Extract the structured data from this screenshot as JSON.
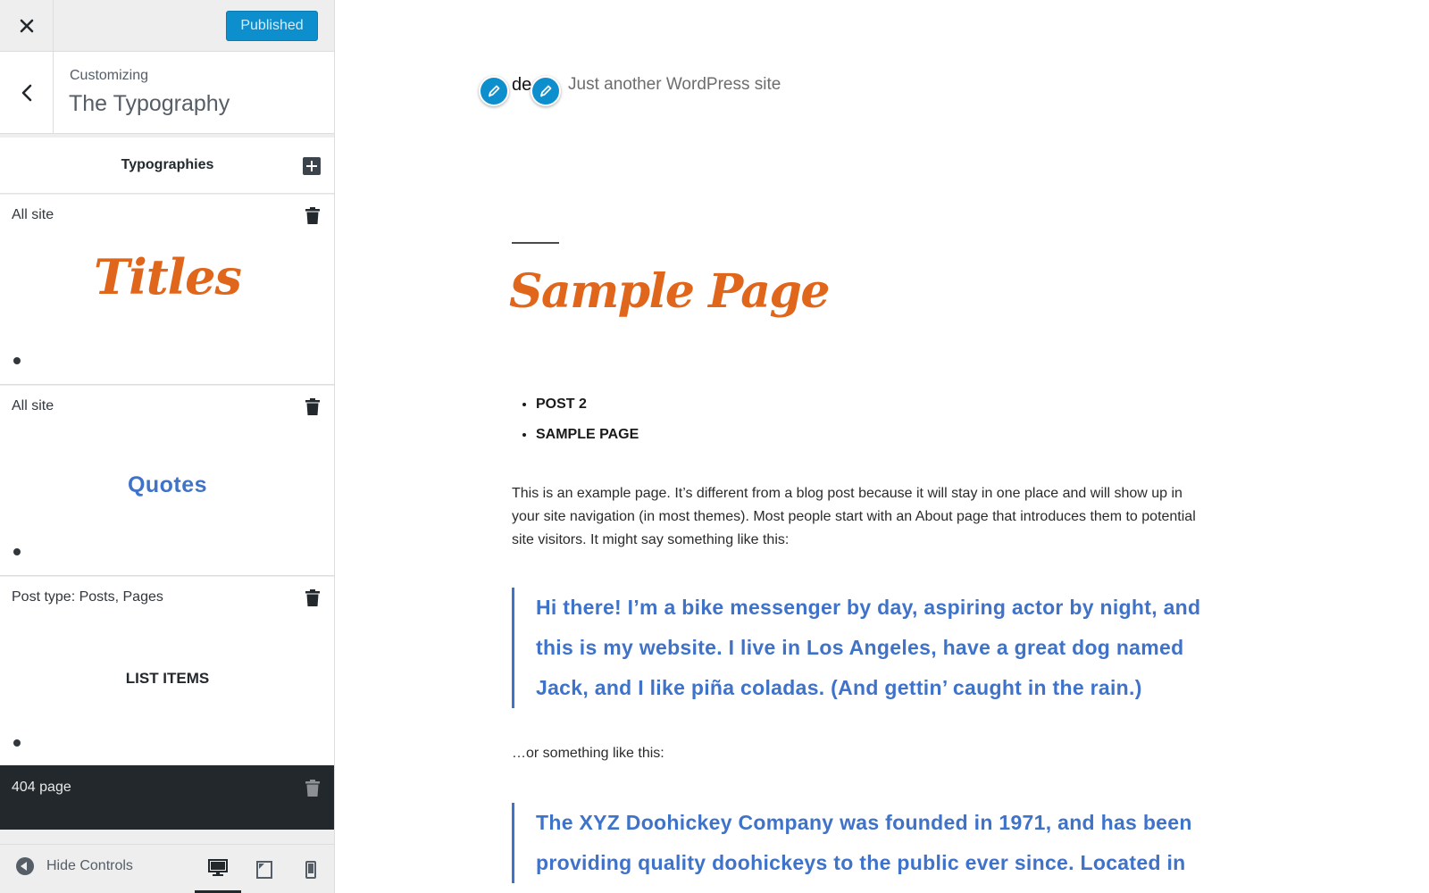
{
  "customizer": {
    "close_icon": "close-icon",
    "publish_label": "Published",
    "section_sub": "Customizing",
    "section_title": "The Typography",
    "panel_title": "Typographies",
    "cards": [
      {
        "location": "All site",
        "preview": "Titles"
      },
      {
        "location": "All site",
        "preview": "Quotes"
      },
      {
        "location": "Post type: Posts, Pages",
        "preview": "LIST ITEMS"
      },
      {
        "location": "404 page"
      }
    ],
    "hide_controls_label": "Hide Controls",
    "devices": [
      "desktop",
      "tablet",
      "mobile"
    ],
    "active_device": "desktop"
  },
  "site": {
    "title": "de",
    "description": "Just another WordPress site",
    "page_title": "Sample Page",
    "menu": [
      "POST 2",
      "SAMPLE PAGE"
    ],
    "intro": "This is an example page. It’s different from a blog post because it will stay in one place and will show up in your site navigation (in most themes). Most people start with an About page that introduces them to potential site visitors. It might say something like this:",
    "quote1": "Hi there! I’m a bike messenger by day, aspiring actor by night, and this is my website. I live in Los Angeles, have a great dog named Jack, and I like piña coladas. (And gettin’ caught in the rain.)",
    "between": "…or something like this:",
    "quote2": "The XYZ Doohickey Company was founded in 1971, and has been providing quality doohickeys to the public ever since. Located in"
  },
  "colors": {
    "accent": "#0d8fce",
    "title_orange": "#e0661c",
    "quote_blue": "#3f72c9",
    "dark_card": "#23282d"
  }
}
